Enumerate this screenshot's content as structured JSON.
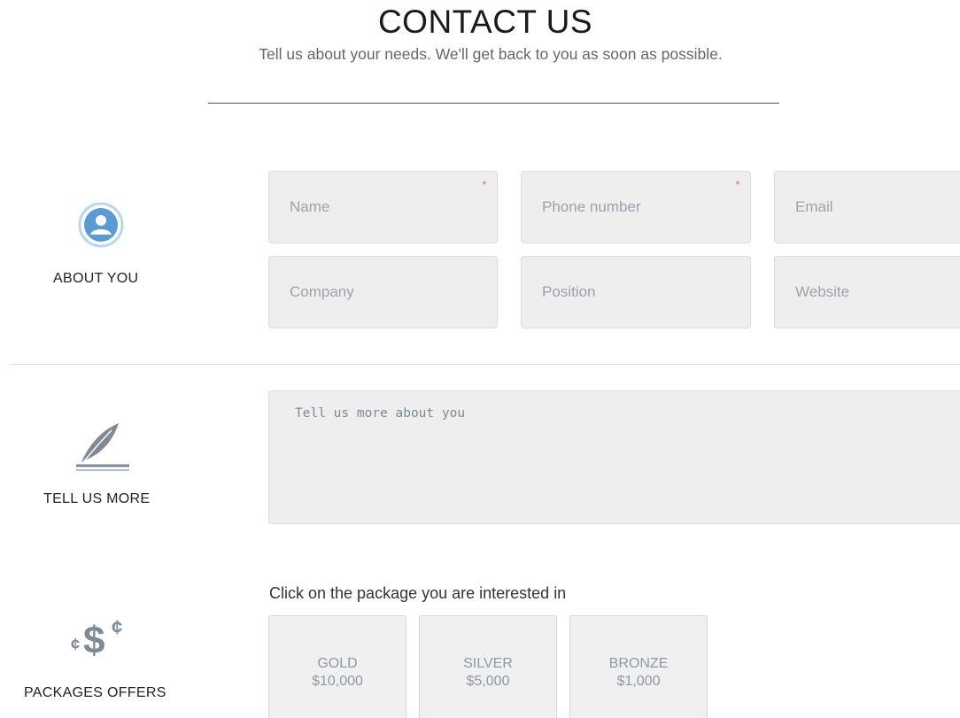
{
  "header": {
    "title": "CONTACT US",
    "subtitle": "Tell us about your needs. We'll get back to you as soon as possible."
  },
  "about": {
    "label": "ABOUT YOU",
    "icon": "user-circle-icon",
    "fields": [
      {
        "placeholder": "Name",
        "required": true
      },
      {
        "placeholder": "Phone number",
        "required": true
      },
      {
        "placeholder": "Email",
        "required": false
      },
      {
        "placeholder": "Company",
        "required": false
      },
      {
        "placeholder": "Position",
        "required": false
      },
      {
        "placeholder": "Website",
        "required": false
      }
    ],
    "required_mark": "*"
  },
  "more": {
    "label": "TELL US MORE",
    "icon": "feather-quill-icon",
    "placeholder": "Tell us more about you"
  },
  "packages": {
    "label": "PACKAGES OFFERS",
    "icon": "dollar-cent-icon",
    "prompt": "Click on the package you are interested in",
    "items": [
      {
        "name": "GOLD",
        "price": "$10,000"
      },
      {
        "name": "SILVER",
        "price": "$5,000"
      },
      {
        "name": "BRONZE",
        "price": "$1,000"
      }
    ]
  },
  "colors": {
    "accent": "#5b9bd5",
    "icon_gray": "#7f8a94",
    "field_bg": "#eeeeee",
    "required": "#e2534d"
  }
}
